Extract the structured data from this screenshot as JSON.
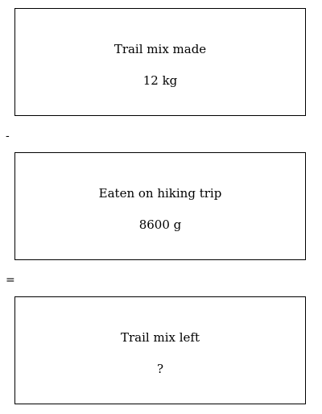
{
  "boxes": {
    "made": {
      "label": "Trail mix made",
      "value": "12 kg"
    },
    "eaten": {
      "label": "Eaten on hiking trip",
      "value": "8600 g"
    },
    "left": {
      "label": "Trail mix left",
      "value": "?"
    }
  },
  "operators": {
    "minus": "-",
    "equals": "="
  }
}
